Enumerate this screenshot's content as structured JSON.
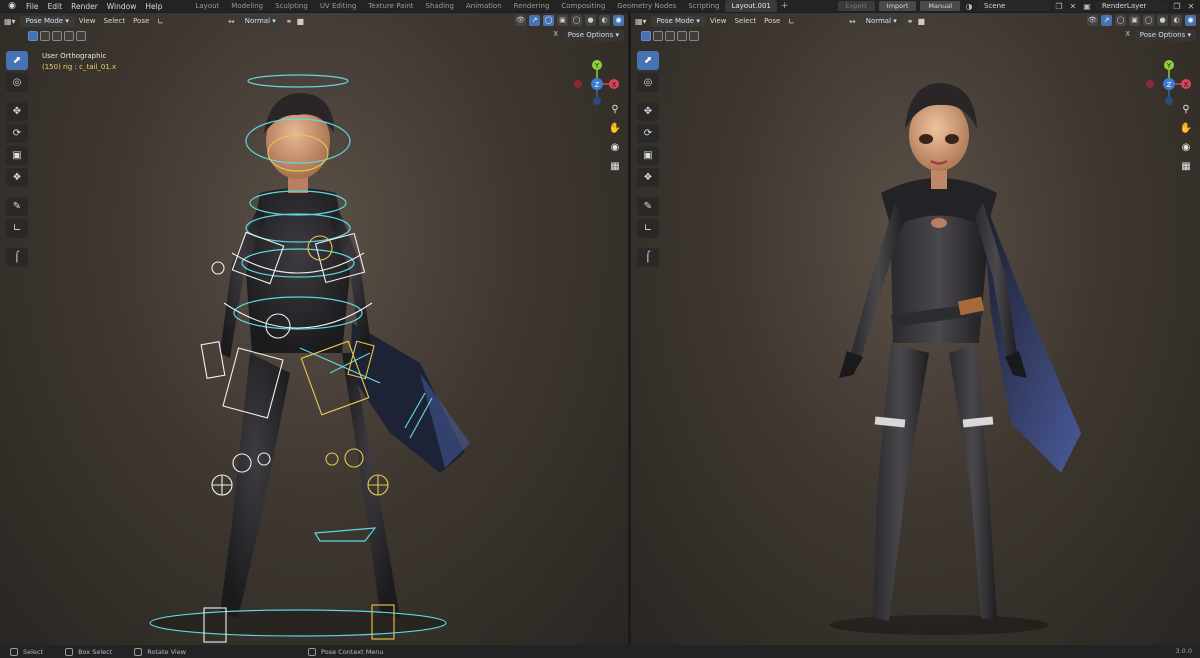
{
  "topbar": {
    "menus": [
      "File",
      "Edit",
      "Render",
      "Window",
      "Help"
    ],
    "workspaces": [
      "Layout",
      "Modeling",
      "Sculpting",
      "UV Editing",
      "Texture Paint",
      "Shading",
      "Animation",
      "Rendering",
      "Compositing",
      "Geometry Nodes",
      "Scripting",
      "Layout.001"
    ],
    "active_workspace": "Layout.001",
    "add_tab": "+",
    "export_label": "Export",
    "import_label": "Import",
    "manual_label": "Manual",
    "scene_name": "Scene",
    "render_layer": "RenderLayer"
  },
  "viewport_left": {
    "mode": "Pose Mode",
    "menus": [
      "View",
      "Select",
      "Pose"
    ],
    "orientation": "Normal",
    "pose_options": "Pose Options",
    "x_label": "X",
    "view_name": "User Orthographic",
    "object_info": "(150) rig : c_tail_01.x"
  },
  "viewport_right": {
    "mode": "Pose Mode",
    "menus": [
      "View",
      "Select",
      "Pose"
    ],
    "orientation": "Normal",
    "pose_options": "Pose Options",
    "x_label": "X"
  },
  "gizmo": {
    "y": "Y",
    "x": "X",
    "z": "Z"
  },
  "statusbar": {
    "select": "Select",
    "box_select": "Box Select",
    "rotate_view": "Rotate View",
    "context_menu": "Pose Context Menu",
    "version": "3.0.0"
  },
  "colors": {
    "accent": "#4772b3",
    "bone_cyan": "#5fd6e0",
    "bone_yellow": "#e8c850",
    "bone_white": "#f0f0f0"
  }
}
